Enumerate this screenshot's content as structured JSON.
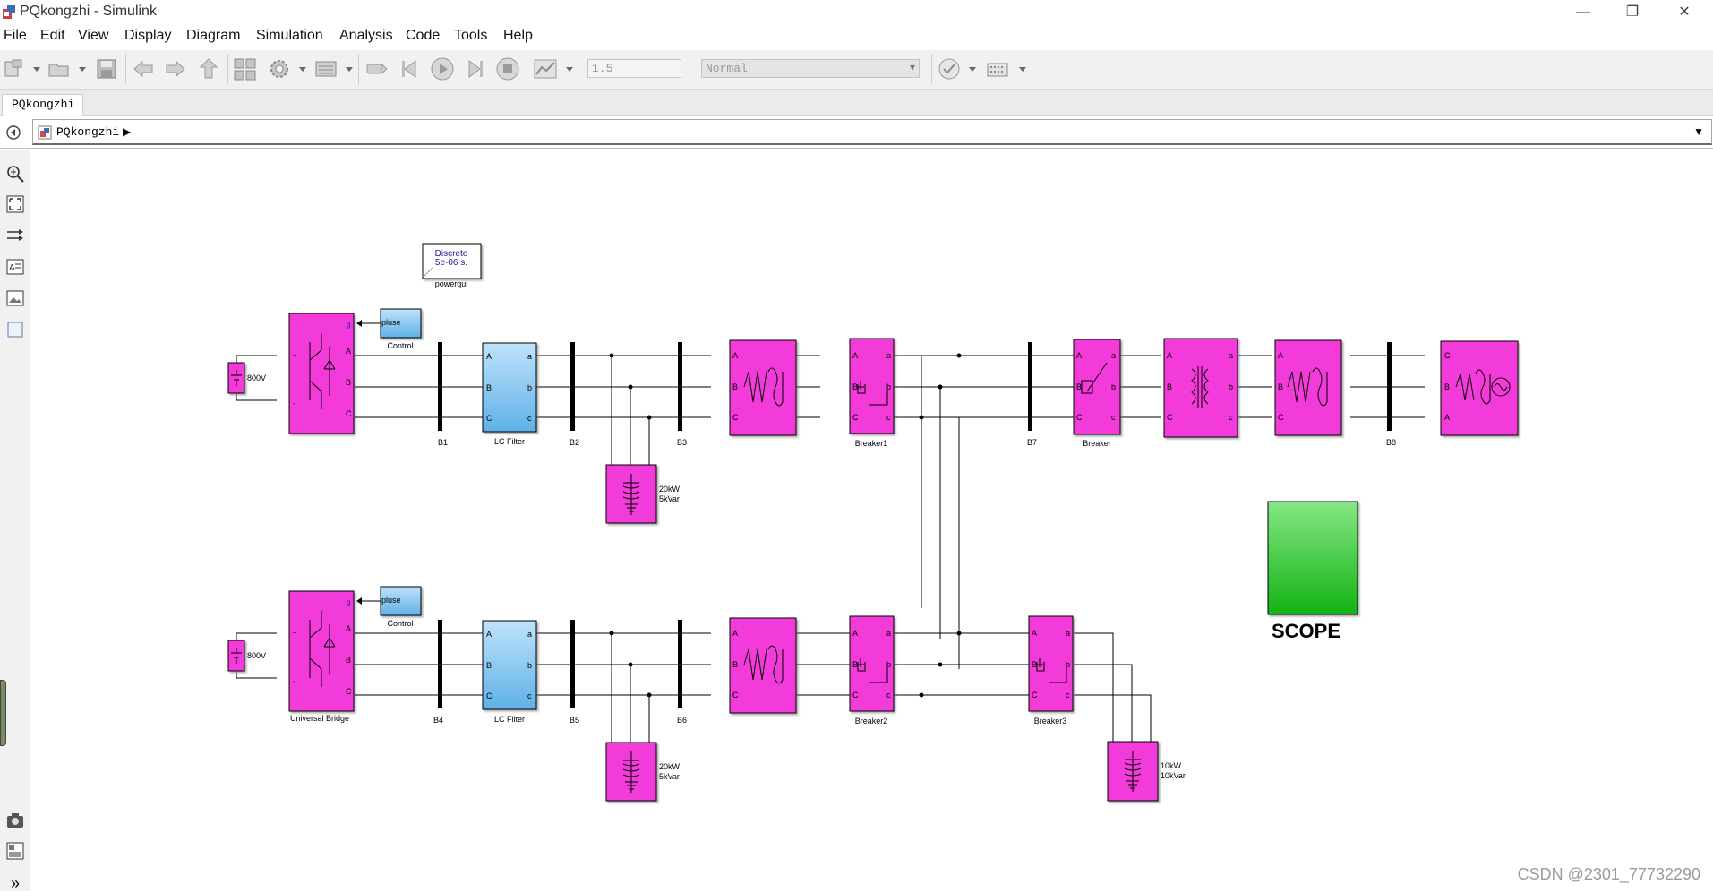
{
  "window": {
    "title": "PQkongzhi - Simulink",
    "controls": [
      "—",
      "❐",
      "✕"
    ]
  },
  "menu": [
    "File",
    "Edit",
    "View",
    "Display",
    "Diagram",
    "Simulation",
    "Analysis",
    "Code",
    "Tools",
    "Help"
  ],
  "toolbar": {
    "stop_time": "1.5",
    "sim_mode": "Normal"
  },
  "tabs": [
    {
      "label": "PQkongzhi"
    }
  ],
  "address": {
    "path": "PQkongzhi"
  },
  "diagram": {
    "powergui": {
      "line1": "Discrete",
      "line2": "5e-06 s.",
      "label": "powergui"
    },
    "dc_sources": [
      "800V",
      "800V"
    ],
    "control_blocks": {
      "text": "pluse",
      "labels": [
        "Control",
        "Control"
      ]
    },
    "bridge_label": "Universal Bridge",
    "filter_labels": [
      "LC Filter",
      "LC Filter"
    ],
    "buses": [
      "B1",
      "B2",
      "B3",
      "B4",
      "B5",
      "B6",
      "B7",
      "B8"
    ],
    "breakers": [
      "Breaker1",
      "Breaker",
      "Breaker2",
      "Breaker3"
    ],
    "loads": [
      {
        "p": "20kW",
        "q": "5kVar"
      },
      {
        "p": "20kW",
        "q": "5kVar"
      },
      {
        "p": "10kW",
        "q": "10kVar"
      }
    ],
    "scope_label": "SCOPE",
    "port_labels": {
      "abc_in": [
        "A",
        "B",
        "C"
      ],
      "abc_out": [
        "a",
        "b",
        "c"
      ],
      "g": "g",
      "plus": "+",
      "minus": "-"
    }
  },
  "watermark": "CSDN @2301_77732290",
  "colors": {
    "block_magenta": "#f23bd8",
    "block_blue": "#8fc9f0",
    "scope_green": "#2fc43f",
    "wire": "#000000"
  }
}
